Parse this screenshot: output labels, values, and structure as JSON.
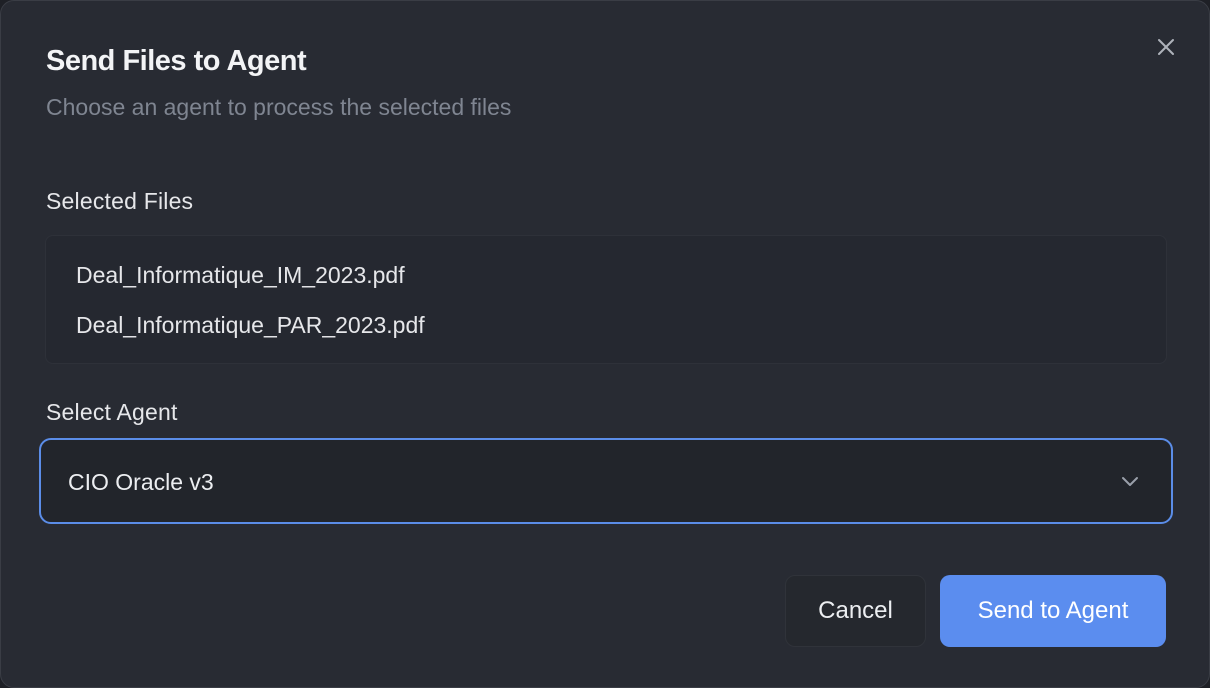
{
  "dialog": {
    "title": "Send Files to Agent",
    "subtitle": "Choose an agent to process the selected files",
    "close_icon": "close-icon"
  },
  "files_section": {
    "label": "Selected Files",
    "files": [
      "Deal_Informatique_IM_2023.pdf",
      "Deal_Informatique_PAR_2023.pdf"
    ]
  },
  "agent_section": {
    "label": "Select Agent",
    "selected_value": "CIO Oracle v3",
    "chevron_icon": "chevron-down-icon"
  },
  "actions": {
    "cancel_label": "Cancel",
    "send_label": "Send to Agent"
  },
  "colors": {
    "dialog_bg": "#282b33",
    "accent": "#5b8def",
    "focus_border": "#5b8de8",
    "muted_text": "#7f8591",
    "primary_text": "#eceef1"
  }
}
